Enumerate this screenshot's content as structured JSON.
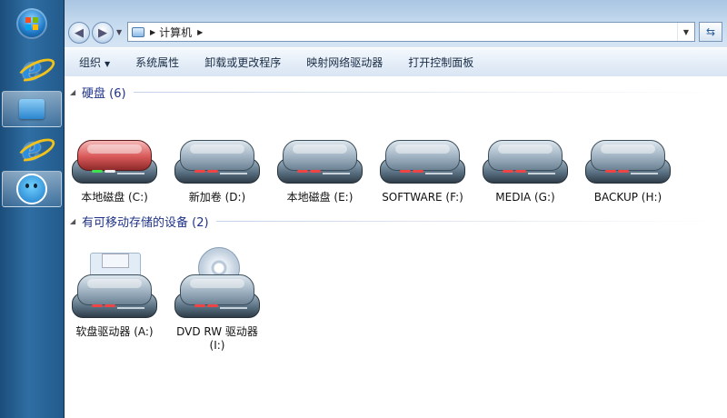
{
  "address_bar": {
    "path": [
      "计算机"
    ]
  },
  "command_bar": {
    "items": [
      "组织",
      "系统属性",
      "卸载或更改程序",
      "映射网络驱动器",
      "打开控制面板"
    ]
  },
  "groups": [
    {
      "title": "硬盘 (6)",
      "items": [
        {
          "label": "本地磁盘 (C:)",
          "icon": "hard-drive-icon-red"
        },
        {
          "label": "新加卷 (D:)",
          "icon": "hard-drive-icon"
        },
        {
          "label": "本地磁盘 (E:)",
          "icon": "hard-drive-icon"
        },
        {
          "label": "SOFTWARE (F:)",
          "icon": "hard-drive-icon"
        },
        {
          "label": "MEDIA (G:)",
          "icon": "hard-drive-icon"
        },
        {
          "label": "BACKUP (H:)",
          "icon": "hard-drive-icon"
        }
      ]
    },
    {
      "title": "有可移动存储的设备 (2)",
      "items": [
        {
          "label": "软盘驱动器 (A:)",
          "icon": "floppy-drive-icon"
        },
        {
          "label": "DVD RW 驱动器 (I:)",
          "icon": "dvd-drive-icon"
        }
      ]
    }
  ],
  "taskbar": {
    "icons": [
      "windows-start-icon",
      "internet-explorer-icon",
      "explorer-folder-icon",
      "internet-explorer-icon",
      "qq-icon"
    ]
  },
  "colors": {
    "accent": "#1e3287",
    "taskbar": "#2f6ea3",
    "command_bar": "#e5eef8"
  }
}
